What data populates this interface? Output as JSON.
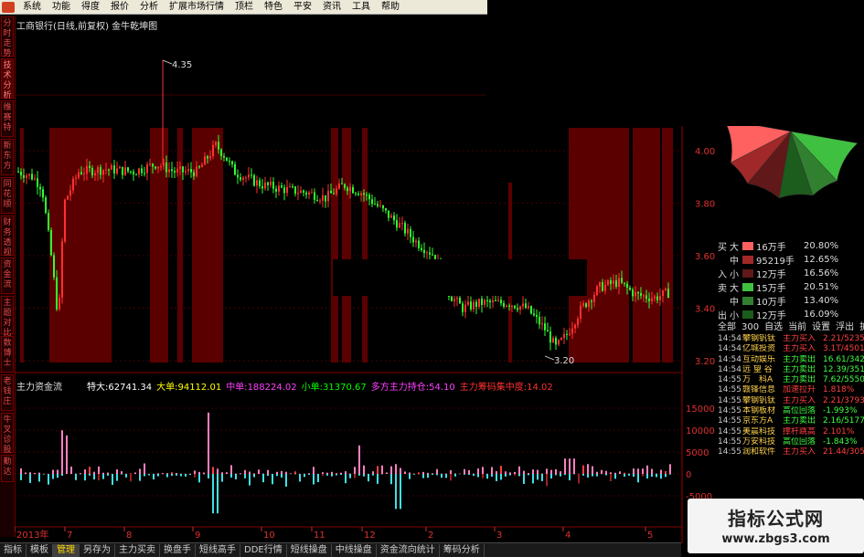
{
  "menu": [
    "系统",
    "功能",
    "报价",
    "分析",
    "扩展市场行情",
    "资讯",
    "工具",
    "帮助",
    "特色",
    "平安",
    "资讯",
    "工具",
    "帮助"
  ],
  "menu_visible": [
    "系统",
    "功能",
    "得度",
    "报价",
    "分析",
    "扩展市场行情",
    "顶栏",
    "特色",
    "平安",
    "资讯",
    "工具",
    "帮助"
  ],
  "side_tabs": [
    "分时走势",
    "技术分析",
    "维赛特",
    "新东方",
    "同花顺",
    "财务透视",
    "资金流",
    "主题对比",
    "数博士",
    "老钱庄",
    "牛叉诊股",
    "勤达"
  ],
  "chart_title": "工商银行(日线,前复权) 金牛乾坤图",
  "price_axis": [
    "4.00",
    "3.80",
    "3.60",
    "3.40",
    "3.20"
  ],
  "high_label": "4.35",
  "low_label": "3.20",
  "indicator": {
    "title": "主力资金流",
    "stats": [
      {
        "label": "特大:",
        "value": "62741.34",
        "color": "#ffffff"
      },
      {
        "label": "大单:",
        "value": "94112.01",
        "color": "#ffff00"
      },
      {
        "label": "中单:",
        "value": "188224.02",
        "color": "#ff40ff"
      },
      {
        "label": "小单:",
        "value": "31370.67",
        "color": "#00ff00"
      },
      {
        "label": "多方主力持仓:",
        "value": "54.10",
        "color": "#ff40ff"
      },
      {
        "label": "主力筹码集中度:",
        "value": "14.02",
        "color": "#ff3030"
      }
    ],
    "axis": [
      "15000",
      "10000",
      "5000",
      "0",
      "-5000"
    ]
  },
  "x_axis": [
    "2013年",
    "7",
    "8",
    "9",
    "10",
    "11",
    "12",
    "2",
    "3",
    "4",
    "5"
  ],
  "bottom_tabs": [
    "指标",
    "模板",
    "管理",
    "另存为",
    "主力买卖",
    "换盘手",
    "短线高手",
    "DDE行情",
    "短线操盘",
    "中线操盘",
    "资金流向统计",
    "筹码分析"
  ],
  "bottom_active": "管理",
  "legend": [
    {
      "side": "买",
      "size": "大",
      "color": "#ff6060",
      "vol": "16万手",
      "pct": "20.80%"
    },
    {
      "side": "",
      "size": "中",
      "color": "#a02828",
      "vol": "95219手",
      "pct": "12.65%"
    },
    {
      "side": "入",
      "size": "小",
      "color": "#601818",
      "vol": "12万手",
      "pct": "16.56%"
    },
    {
      "side": "卖",
      "size": "大",
      "color": "#40c040",
      "vol": "15万手",
      "pct": "20.51%"
    },
    {
      "side": "",
      "size": "中",
      "color": "#308030",
      "vol": "10万手",
      "pct": "13.40%"
    },
    {
      "side": "出",
      "size": "小",
      "color": "#1c5c1c",
      "vol": "12万手",
      "pct": "16.09%"
    }
  ],
  "rp_toolbar": [
    "全部",
    "300",
    "自选",
    "当前",
    "设置",
    "浮出",
    "扩大"
  ],
  "trades": [
    {
      "t": "14:54",
      "n": "攀钢钒钛",
      "a": "主力买入",
      "v": "2.21/5235",
      "c": "#ff4040"
    },
    {
      "t": "14:54",
      "n": "亿城投资",
      "a": "主力买入",
      "v": "3.1T/4501",
      "c": "#ff4040"
    },
    {
      "t": "14:54",
      "n": "互动娱乐",
      "a": "主力卖出",
      "v": "16.61/342",
      "c": "#40ff40"
    },
    {
      "t": "14:54",
      "n": "远 望 谷",
      "a": "主力卖出",
      "v": "12.39/351",
      "c": "#40ff40"
    },
    {
      "t": "14:55",
      "n": "万　科A",
      "a": "主力卖出",
      "v": "7.62/5550",
      "c": "#40ff40"
    },
    {
      "t": "14:55",
      "n": "赣锋信息",
      "a": "加速拉升",
      "v": "1.818%",
      "c": "#ff4040"
    },
    {
      "t": "14:55",
      "n": "攀钢钒钛",
      "a": "主力买入",
      "v": "2.21/3793",
      "c": "#ff4040"
    },
    {
      "t": "14:55",
      "n": "本钢板材",
      "a": "高位回落",
      "v": "-1.993%",
      "c": "#40ff40"
    },
    {
      "t": "14:55",
      "n": "京东方A",
      "a": "主力卖出",
      "v": "2.16/5177",
      "c": "#40ff40"
    },
    {
      "t": "14:55",
      "n": "美晨科技",
      "a": "撑杆跳高",
      "v": "2.101%",
      "c": "#ff4040"
    },
    {
      "t": "14:55",
      "n": "万安科技",
      "a": "高位回落",
      "v": "-1.843%",
      "c": "#40ff40"
    },
    {
      "t": "14:55",
      "n": "润和软件",
      "a": "主力买入",
      "v": "21.44/305",
      "c": "#ff4040"
    }
  ],
  "watermark": {
    "line1": "指标公式网",
    "line2": "www.zbgs3.com"
  },
  "colors": {
    "up": "#ff3030",
    "down": "#30ff30",
    "zone": "#5a0000",
    "cyan": "#40e0e8",
    "pink": "#ff80c0",
    "grid": "#800000"
  }
}
